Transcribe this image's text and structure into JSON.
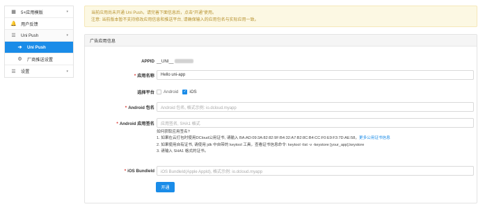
{
  "sidebar": {
    "items": [
      {
        "label": "5+应用模版",
        "icon": "grid-icon",
        "glyph": "▦",
        "caret": "▾",
        "type": "group"
      },
      {
        "label": "用户反馈",
        "icon": "bell-icon",
        "glyph": "🔔",
        "caret": "",
        "type": "item"
      },
      {
        "label": "Uni Push",
        "icon": "list-icon",
        "glyph": "☰",
        "caret": "▾",
        "type": "group-open"
      },
      {
        "label": "Uni Push",
        "icon": "arrow-icon",
        "glyph": "➔",
        "caret": "",
        "type": "active"
      },
      {
        "label": "厂商推送设置",
        "icon": "gear-icon",
        "glyph": "⚙",
        "caret": "",
        "type": "sub"
      },
      {
        "label": "设置",
        "icon": "list-icon",
        "glyph": "☰",
        "caret": "▾",
        "type": "group"
      }
    ]
  },
  "alert": {
    "line1": "当前应用尚未开通 Uni Push，请完善下面信息后，点击“开通”使用。",
    "line2": "注意: 当前版本暂不支持修改应用信息和推送平台, 请确保输入的应用包名与实际应用一致。"
  },
  "panel": {
    "title": "广告应用信息",
    "appid_label": "APPID",
    "appid_value": "__UNI__",
    "app_name_label": "应用名称",
    "app_name_value": "Hello uni-app",
    "platform_label": "选择平台",
    "platform_android": "Android",
    "platform_ios": "iOS",
    "android_pkg_label": "Android 包名",
    "android_pkg_placeholder": "Android 包名, 格式示例: io.dcloud.myapp",
    "android_sig_label": "Android 应用签名",
    "android_sig_placeholder": "应用签名, SHA1 格式",
    "help": {
      "title": "如何获取应用签名?",
      "line1": "1. 如果在云打包时使用DCloud公用证书, 请输入 BA:AD:09:3A:82:82:9F:B4:32:A7:B2:8C:B4:CC:F0:E9:F3:7D:AE:58，",
      "line1_link": "更多公用证书信息",
      "line2": "2. 如果使用自有证书, 请使用 jdk 中自带的 keytool 工具，查看证书信息命令: keytool -list -v -keystore [your_app].keystore",
      "line3": "3. 请输入 SHA1 格式的证书。"
    },
    "ios_label": "iOS BundleId",
    "ios_placeholder": "iOS BundleId(Apple AppId), 格式示例: io.dcloud.myapp",
    "submit_label": "开通"
  }
}
